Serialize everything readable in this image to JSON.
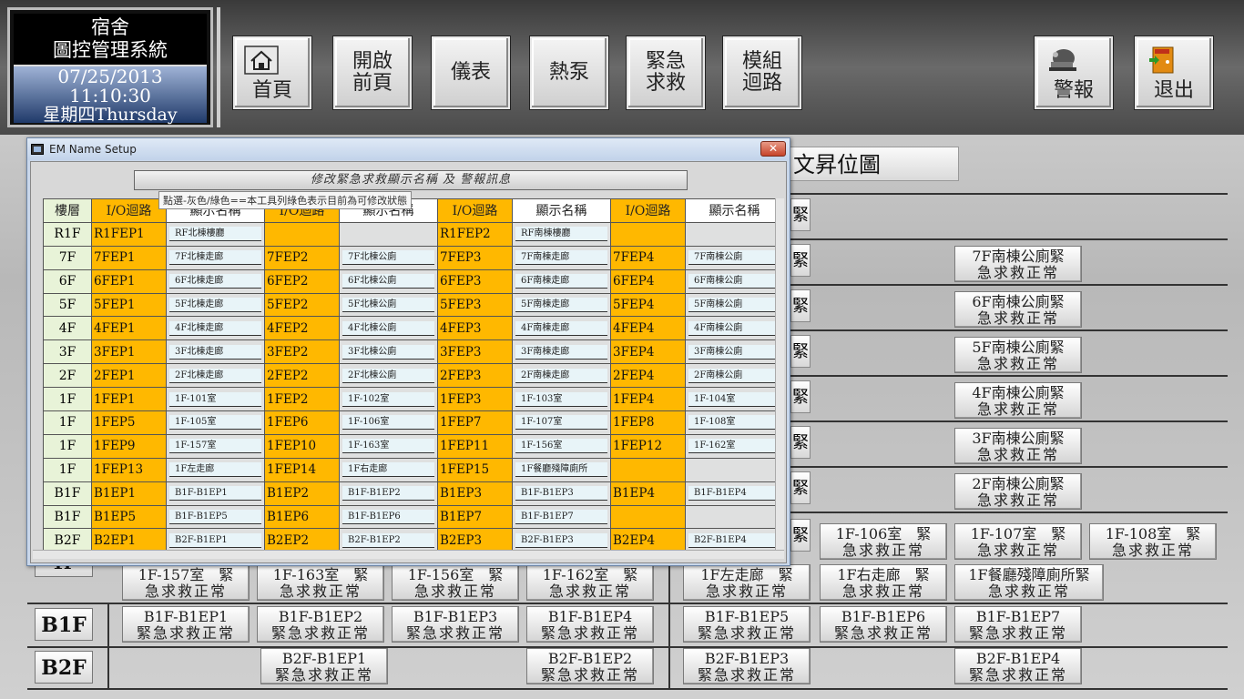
{
  "header": {
    "system_line1": "宿舍",
    "system_line2": "圖控管理系統",
    "date": "07/25/2013",
    "time": "11:10:30",
    "weekday": "星期四Thursday",
    "buttons": {
      "home": "首頁",
      "open_prev_line1": "開啟",
      "open_prev_line2": "前頁",
      "meter": "儀表",
      "heat_pump": "熱泵",
      "emergency_line1": "緊急",
      "emergency_line2": "求救",
      "module_line1": "模組",
      "module_line2": "迴路",
      "alarm": "警報",
      "exit": "退出"
    }
  },
  "main": {
    "title_partial": "文昇位圖",
    "status_text": "急求救正常",
    "status_text_b": "緊急求救正常",
    "edge_char": "緊",
    "right_col": [
      {
        "line1": "7F南棟公廁緊",
        "line2": "急求救正常"
      },
      {
        "line1": "6F南棟公廁緊",
        "line2": "急求救正常"
      },
      {
        "line1": "5F南棟公廁緊",
        "line2": "急求救正常"
      },
      {
        "line1": "4F南棟公廁緊",
        "line2": "急求救正常"
      },
      {
        "line1": "3F南棟公廁緊",
        "line2": "急求救正常"
      },
      {
        "line1": "2F南棟公廁緊",
        "line2": "急求救正常"
      }
    ],
    "row_1f_top": [
      "1F-106室　緊",
      "1F-107室　緊",
      "1F-108室　緊"
    ],
    "row_1f_bottom": [
      "1F-157室　緊",
      "1F-163室　緊",
      "1F-156室　緊",
      "1F-162室　緊",
      "1F左走廊　緊",
      "1F右走廊　緊",
      "1F餐廳殘障廁所緊"
    ],
    "b1f_label": "B1F",
    "b1f": [
      "B1F-B1EP1",
      "B1F-B1EP2",
      "B1F-B1EP3",
      "B1F-B1EP4",
      "B1F-B1EP5",
      "B1F-B1EP6",
      "B1F-B1EP7"
    ],
    "b2f_label": "B2F",
    "b2f": [
      "B2F-B1EP1",
      "B2F-B1EP2",
      "B2F-B1EP3",
      "B2F-B1EP4"
    ],
    "partial_label": "1F"
  },
  "dialog": {
    "title": "EM Name Setup",
    "close_glyph": "✕",
    "banner": "修改緊急求救顯示名稱 及 警報訊息",
    "tooltip": "點選-灰色/綠色==本工具列綠色表示目前為可修改狀態",
    "headers": [
      "樓層",
      "I/O迴路",
      "顯示名稱",
      "I/O迴路",
      "顯示名稱",
      "I/O迴路",
      "顯示名稱",
      "I/O迴路",
      "顯示名稱"
    ],
    "rows": [
      {
        "floor": "R1F",
        "cells": [
          [
            "R1FEP1",
            "RF北棟樓廳"
          ],
          [
            "",
            ""
          ],
          [
            "R1FEP2",
            "RF南棟樓廳"
          ],
          [
            "",
            ""
          ]
        ]
      },
      {
        "floor": "7F",
        "cells": [
          [
            "7FEP1",
            "7F北棟走廊"
          ],
          [
            "7FEP2",
            "7F北棟公廁"
          ],
          [
            "7FEP3",
            "7F南棟走廊"
          ],
          [
            "7FEP4",
            "7F南棟公廁"
          ]
        ]
      },
      {
        "floor": "6F",
        "cells": [
          [
            "6FEP1",
            "6F北棟走廊"
          ],
          [
            "6FEP2",
            "6F北棟公廁"
          ],
          [
            "6FEP3",
            "6F南棟走廊"
          ],
          [
            "6FEP4",
            "6F南棟公廁"
          ]
        ]
      },
      {
        "floor": "5F",
        "cells": [
          [
            "5FEP1",
            "5F北棟走廊"
          ],
          [
            "5FEP2",
            "5F北棟公廁"
          ],
          [
            "5FEP3",
            "5F南棟走廊"
          ],
          [
            "5FEP4",
            "5F南棟公廁"
          ]
        ]
      },
      {
        "floor": "4F",
        "cells": [
          [
            "4FEP1",
            "4F北棟走廊"
          ],
          [
            "4FEP2",
            "4F北棟公廁"
          ],
          [
            "4FEP3",
            "4F南棟走廊"
          ],
          [
            "4FEP4",
            "4F南棟公廁"
          ]
        ]
      },
      {
        "floor": "3F",
        "cells": [
          [
            "3FEP1",
            "3F北棟走廊"
          ],
          [
            "3FEP2",
            "3F北棟公廁"
          ],
          [
            "3FEP3",
            "3F南棟走廊"
          ],
          [
            "3FEP4",
            "3F南棟公廁"
          ]
        ]
      },
      {
        "floor": "2F",
        "cells": [
          [
            "2FEP1",
            "2F北棟走廊"
          ],
          [
            "2FEP2",
            "2F北棟公廁"
          ],
          [
            "2FEP3",
            "2F南棟走廊"
          ],
          [
            "2FEP4",
            "2F南棟公廁"
          ]
        ]
      },
      {
        "floor": "1F",
        "cells": [
          [
            "1FEP1",
            "1F-101室"
          ],
          [
            "1FEP2",
            "1F-102室"
          ],
          [
            "1FEP3",
            "1F-103室"
          ],
          [
            "1FEP4",
            "1F-104室"
          ]
        ]
      },
      {
        "floor": "1F",
        "cells": [
          [
            "1FEP5",
            "1F-105室"
          ],
          [
            "1FEP6",
            "1F-106室"
          ],
          [
            "1FEP7",
            "1F-107室"
          ],
          [
            "1FEP8",
            "1F-108室"
          ]
        ]
      },
      {
        "floor": "1F",
        "cells": [
          [
            "1FEP9",
            "1F-157室"
          ],
          [
            "1FEP10",
            "1F-163室"
          ],
          [
            "1FEP11",
            "1F-156室"
          ],
          [
            "1FEP12",
            "1F-162室"
          ]
        ]
      },
      {
        "floor": "1F",
        "cells": [
          [
            "1FEP13",
            "1F左走廊"
          ],
          [
            "1FEP14",
            "1F右走廊"
          ],
          [
            "1FEP15",
            "1F餐廳殘障廁所"
          ],
          [
            "",
            ""
          ]
        ]
      },
      {
        "floor": "B1F",
        "cells": [
          [
            "B1EP1",
            "B1F-B1EP1"
          ],
          [
            "B1EP2",
            "B1F-B1EP2"
          ],
          [
            "B1EP3",
            "B1F-B1EP3"
          ],
          [
            "B1EP4",
            "B1F-B1EP4"
          ]
        ]
      },
      {
        "floor": "B1F",
        "cells": [
          [
            "B1EP5",
            "B1F-B1EP5"
          ],
          [
            "B1EP6",
            "B1F-B1EP6"
          ],
          [
            "B1EP7",
            "B1F-B1EP7"
          ],
          [
            "",
            ""
          ]
        ]
      },
      {
        "floor": "B2F",
        "cells": [
          [
            "B2EP1",
            "B2F-B1EP1"
          ],
          [
            "B2EP2",
            "B2F-B1EP2"
          ],
          [
            "B2EP3",
            "B2F-B1EP3"
          ],
          [
            "B2EP4",
            "B2F-B1EP4"
          ]
        ]
      }
    ]
  },
  "colors": {
    "io_orange": "#ffb800",
    "floor_green": "#e8f3d8",
    "clock_blue": "#203a6a"
  }
}
